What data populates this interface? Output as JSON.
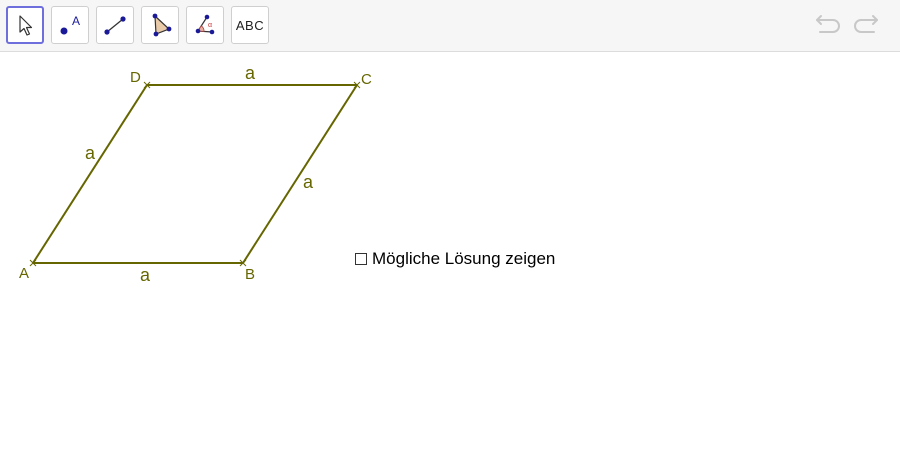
{
  "toolbar": {
    "tools": [
      {
        "id": "move",
        "icon": "cursor-arrow-icon",
        "active": true
      },
      {
        "id": "point",
        "icon": "point-icon",
        "label": "A"
      },
      {
        "id": "segment",
        "icon": "segment-icon"
      },
      {
        "id": "polygon",
        "icon": "polygon-icon"
      },
      {
        "id": "angle",
        "icon": "angle-icon",
        "label": "α"
      },
      {
        "id": "text",
        "icon": "text-icon",
        "label": "ABC"
      }
    ],
    "undo_icon": "undo-icon",
    "redo_icon": "redo-icon"
  },
  "construction": {
    "points": {
      "A": "A",
      "B": "B",
      "C": "C",
      "D": "D"
    },
    "side_label": "a",
    "stroke_color": "#666600",
    "label_color": "#666600"
  },
  "checkbox": {
    "label": "Mögliche Lösung zeigen",
    "checked": false
  }
}
